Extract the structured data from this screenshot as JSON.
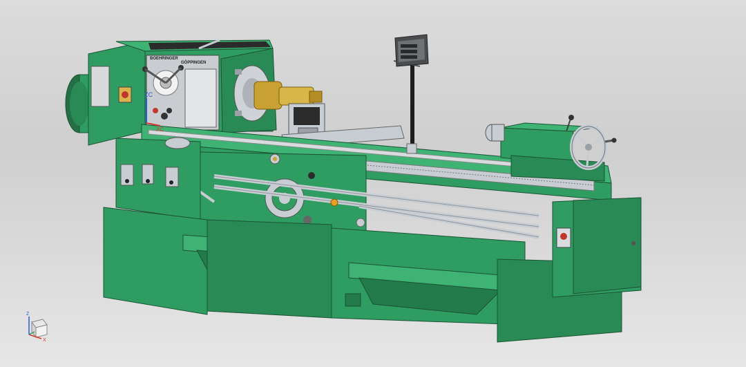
{
  "viewport": {
    "background_top": "#dcdcdc",
    "background_bottom": "#e6e6e6"
  },
  "model": {
    "body_color": "#2f9c62",
    "body_dark": "#237a4b",
    "body_light": "#3fb374",
    "steel_color": "#c8cdd3",
    "brass_color": "#c9a032",
    "headstock_plate_left": "BOEHRINGER",
    "headstock_plate_right": "GÖPPINGEN"
  },
  "csys_labels": {
    "zc": "ZC",
    "xc": "XC"
  },
  "triad": {
    "z_label": "Z",
    "x_label": "X",
    "z_color": "#2a5bd7",
    "x_color": "#d43a2f"
  }
}
